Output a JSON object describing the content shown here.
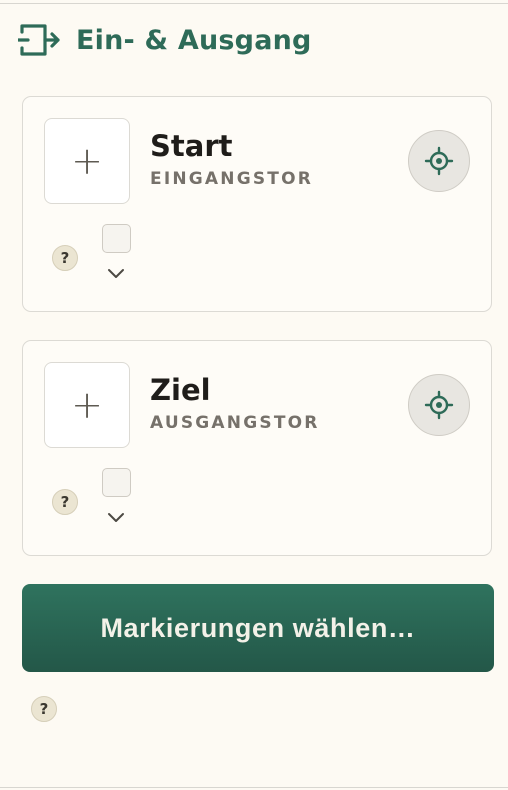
{
  "header": {
    "icon": "entry-exit-icon",
    "title": "Ein- & Ausgang"
  },
  "cards": [
    {
      "name": "Start",
      "subtitle": "EINGANGSTOR",
      "add_symbol": "+",
      "help_symbol": "?"
    },
    {
      "name": "Ziel",
      "subtitle": "AUSGANGSTOR",
      "add_symbol": "+",
      "help_symbol": "?"
    }
  ],
  "primary_button": {
    "label": "Markierungen wählen…"
  },
  "footer": {
    "help_symbol": "?"
  },
  "colors": {
    "accent": "#2e6b58",
    "button_bg": "#2a6553",
    "background": "#fdfaf3"
  }
}
